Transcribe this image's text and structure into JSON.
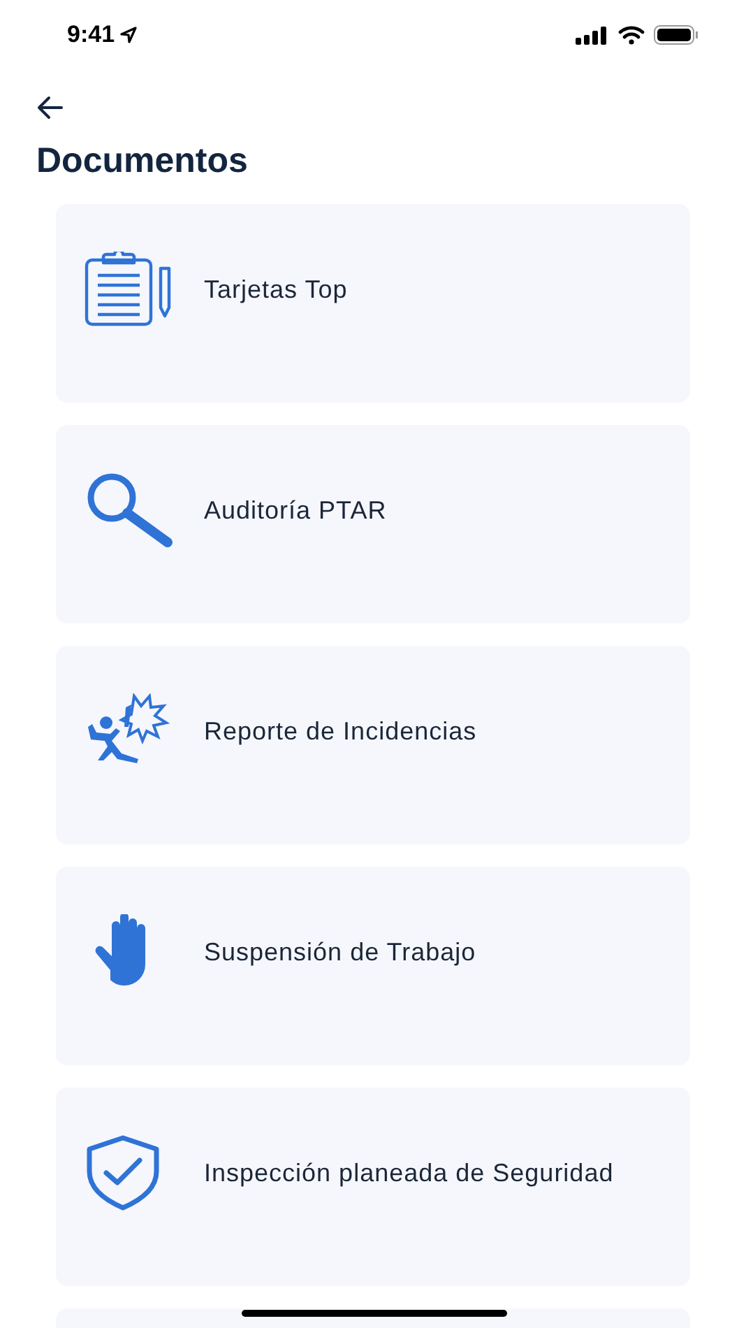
{
  "status_bar": {
    "time": "9:41"
  },
  "header": {
    "title": "Documentos"
  },
  "documents": [
    {
      "kind": "clipboard",
      "label": "Tarjetas Top"
    },
    {
      "kind": "magnifier",
      "label": "Auditoría PTAR"
    },
    {
      "kind": "incident",
      "label": "Reporte de Incidencias"
    },
    {
      "kind": "hand",
      "label": "Suspensión de Trabajo"
    },
    {
      "kind": "shield",
      "label": "Inspección planeada de Seguridad"
    }
  ]
}
